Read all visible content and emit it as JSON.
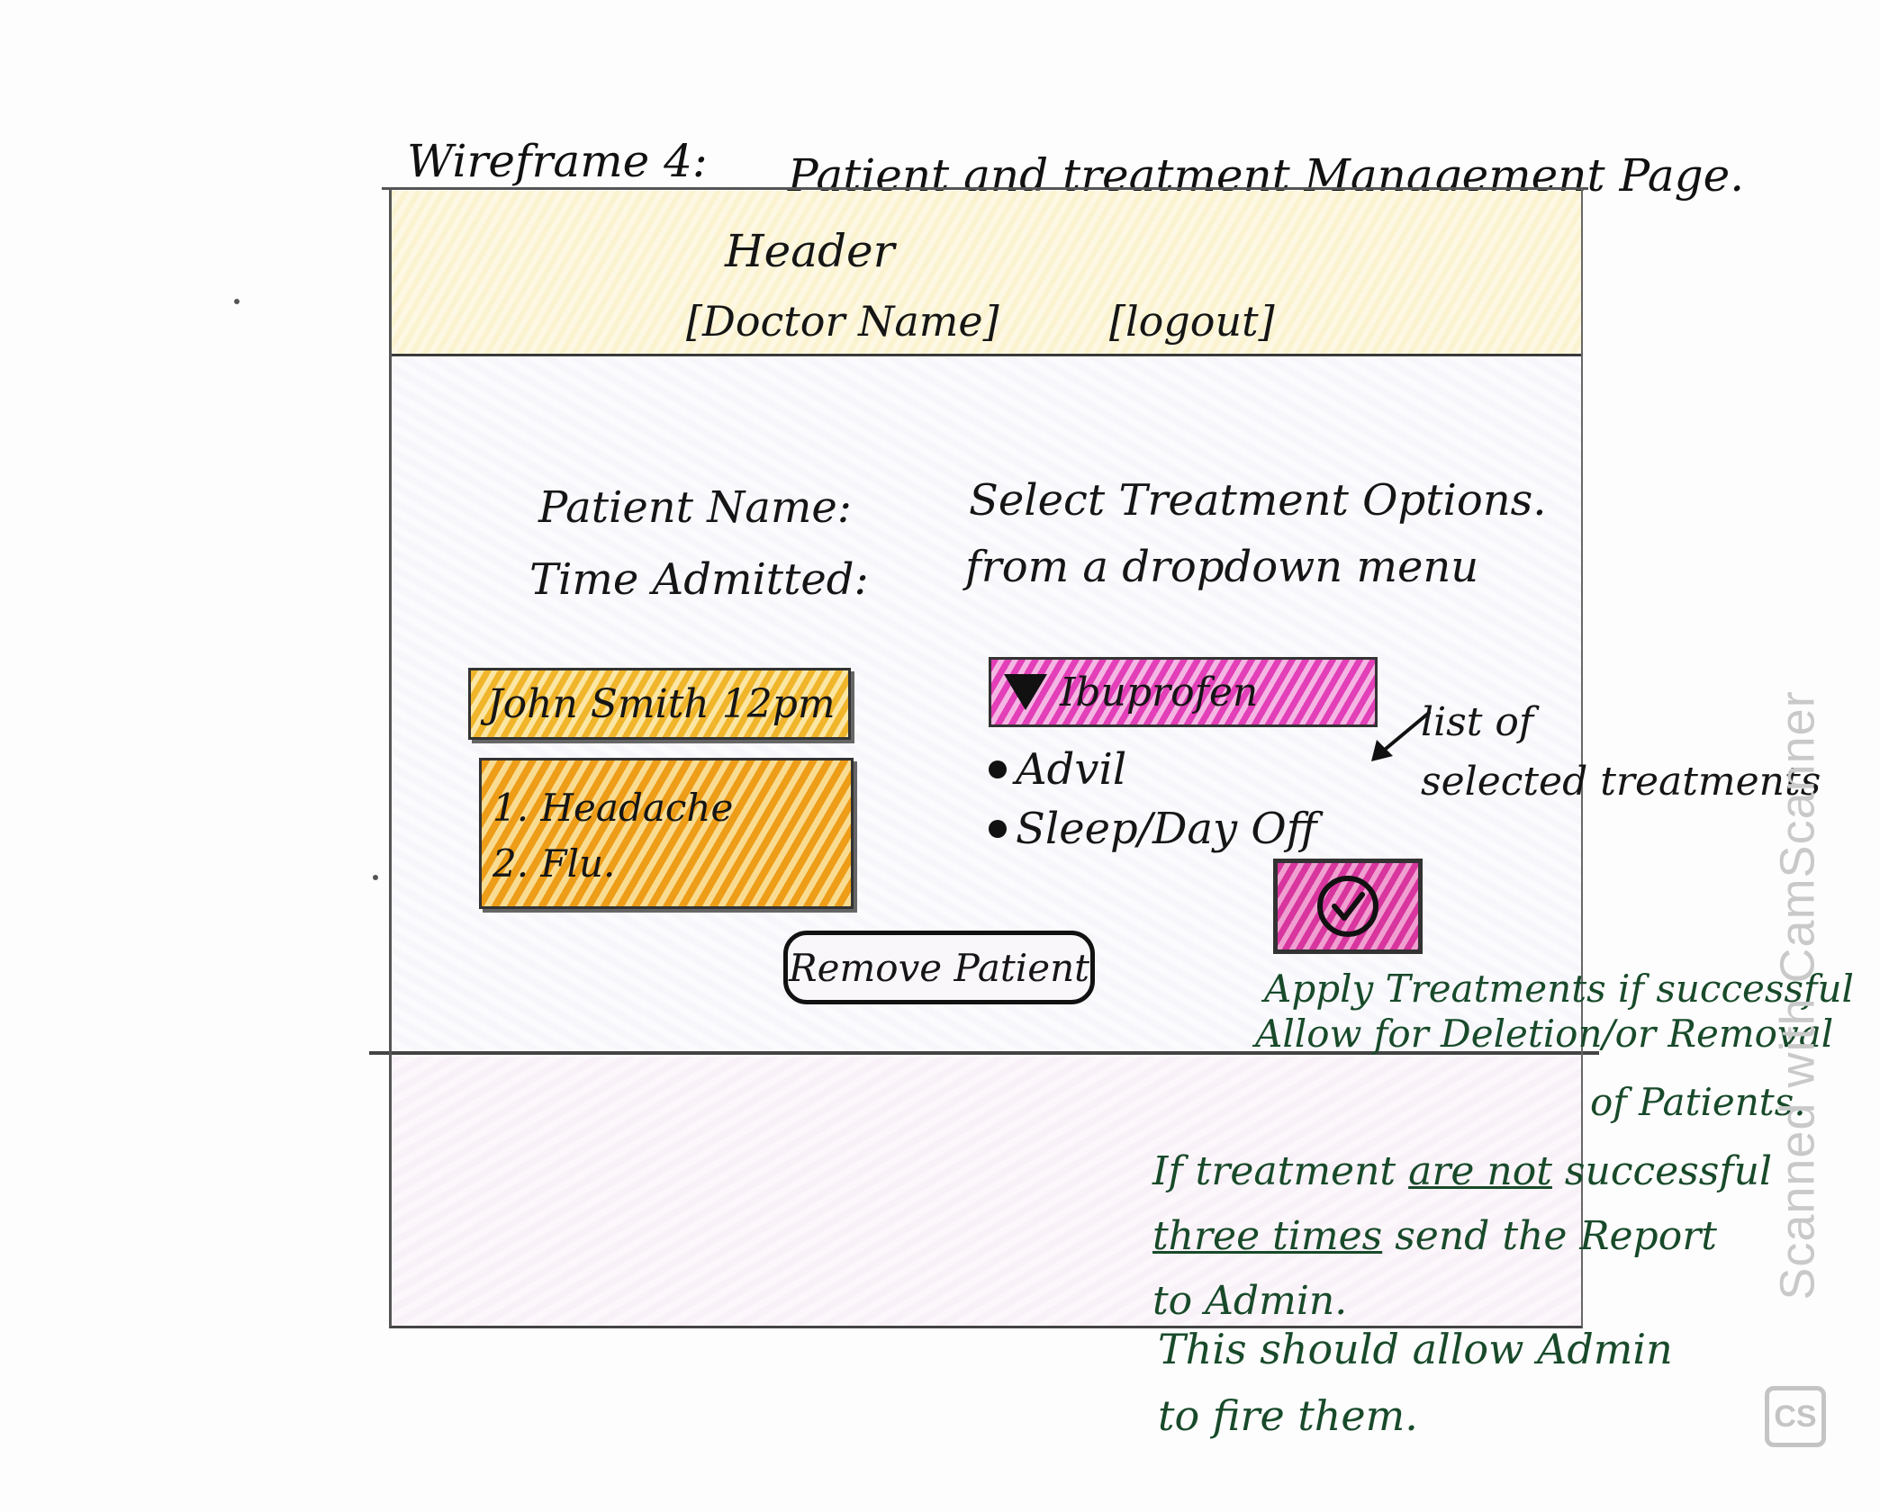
{
  "wireframe": {
    "label": "Wireframe 4:",
    "title": "Patient and treatment Management Page."
  },
  "header": {
    "label": "Header",
    "doctor_name": "[Doctor Name]",
    "logout": "[logout]"
  },
  "patient": {
    "name_label": "Patient Name:",
    "time_label": "Time Admitted:",
    "record": "John Smith 12pm",
    "symptoms": [
      "1. Headache",
      "2. Flu."
    ],
    "remove_button": "Remove Patient"
  },
  "treatment": {
    "instruction_line1": "Select Treatment Options.",
    "instruction_line2": "from a dropdown menu",
    "dropdown_selected": "Ibuprofen",
    "selected_list": [
      "Advil",
      "Sleep/Day Off"
    ],
    "list_annotation_line1": "list of",
    "list_annotation_line2": "selected treatments"
  },
  "notes": {
    "apply": "Apply Treatments if successful",
    "deletion": "Allow for Deletion/or Removal",
    "deletion2": "of Patients.",
    "report_line1_a": "If treatment",
    "report_line1_b": "are not",
    "report_line1_c": "successful",
    "report_line2_a": "three times",
    "report_line2_b": "send the Report",
    "report_line3": "to Admin.",
    "admin_line1": "This should allow Admin",
    "admin_line2": "to fire them."
  },
  "watermark": {
    "text": "Scanned with CamScanner",
    "icon": "CS"
  },
  "icons": {
    "dropdown": "caret-down-icon",
    "apply": "check-circle-icon",
    "arrow": "arrow-icon"
  },
  "colors": {
    "header_fill": "#fbf3d0",
    "patient_fill": "#f0b52a",
    "treatment_fill": "#e23fb8",
    "note_ink": "#184a2a"
  }
}
